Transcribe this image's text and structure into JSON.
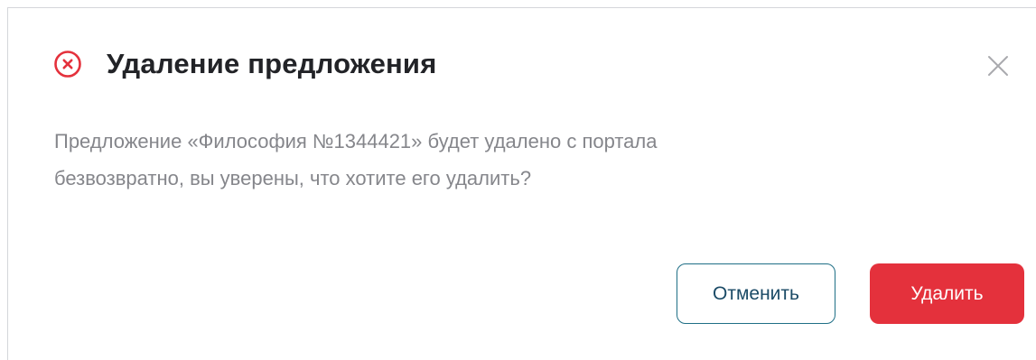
{
  "dialog": {
    "title": "Удаление предложения",
    "message": "Предложение «Философия №1344421» будет удалено с портала\nбезвозвратно, вы уверены, что хотите его удалить?",
    "icon": "error-circle-icon",
    "close_icon": "close-icon"
  },
  "actions": {
    "cancel_label": "Отменить",
    "delete_label": "Удалить"
  },
  "colors": {
    "danger": "#e4313c",
    "cancel_border": "#1f6f86",
    "cancel_text": "#1a4a66",
    "title": "#222327",
    "body_text": "#85868b"
  }
}
